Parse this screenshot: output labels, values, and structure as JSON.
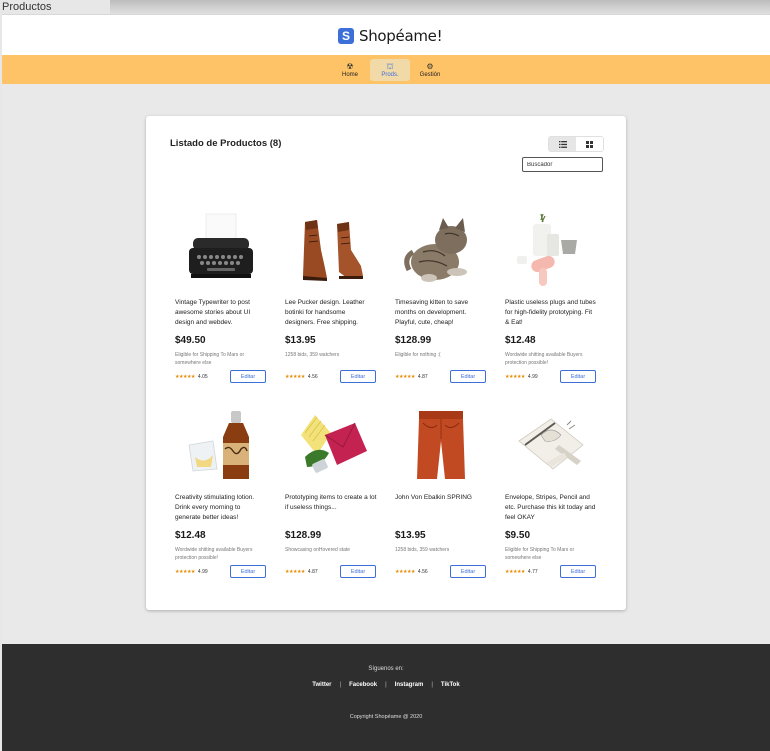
{
  "window": {
    "title": "Productos"
  },
  "brand": {
    "logo_letter": "S",
    "name": "Shopéame!",
    "accent": "#3d6fd9"
  },
  "nav": {
    "items": [
      {
        "icon": "radioactive-icon",
        "glyph": "☢",
        "label": "Home"
      },
      {
        "icon": "bag-icon",
        "glyph": "⛫",
        "label": "Prods."
      },
      {
        "icon": "gear-icon",
        "glyph": "⚙",
        "label": "Gestión"
      }
    ],
    "active": "Prods.",
    "bar_color": "#fdc366"
  },
  "listing": {
    "title": "Listado de Productos (8)",
    "view_modes": [
      "list",
      "grid"
    ],
    "active_view": "list",
    "search_placeholder": "Buscador"
  },
  "products": [
    {
      "title": "Vintage Typewriter to post awesome stories about UI design and webdev.",
      "price": "$49.50",
      "info": "Eligible for Shipping To Mars or somewhere else",
      "rating": "4.05",
      "button": "Editar",
      "image": "typewriter"
    },
    {
      "title": "Lee Pucker design. Leather botinki for handsome designers. Free shipping.",
      "price": "$13.95",
      "info": "1258 bids, 359 watchers",
      "rating": "4.56",
      "button": "Editar",
      "image": "boots"
    },
    {
      "title": "Timesaving kitten to save months on development. Playful, cute, cheap!",
      "price": "$128.99",
      "info": "Eligible for nothing :(",
      "rating": "4.87",
      "button": "Editar",
      "image": "kitten"
    },
    {
      "title": "Plastic useless plugs and tubes for high-fidelity prototyping. Fit & Eat!",
      "price": "$12.48",
      "info": "Wordwide shitting available Buyers protection possible!",
      "rating": "4.99",
      "button": "Editar",
      "image": "plugs"
    },
    {
      "title": "Creativity stimulating lotion. Drink every morning to generate better ideas!",
      "price": "$12.48",
      "info": "Wordwide shitting available Buyers protection possible!",
      "rating": "4.99",
      "button": "Editar",
      "image": "bottle"
    },
    {
      "title": "Prototyping items to create a lot if useless things...",
      "price": "$128.99",
      "info": "Showcasing onHovered state",
      "rating": "4.87",
      "button": "Editar",
      "image": "envelope-pink"
    },
    {
      "title": "John Von Ebalkin SPRING",
      "price": "$13.95",
      "info": "1258 bids, 359 watchers",
      "rating": "4.56",
      "button": "Editar",
      "image": "pants"
    },
    {
      "title": "Envelope, Stripes, Pencil and etc. Purchase this kit today and feel OKAY",
      "price": "$9.50",
      "info": "Eligible for Shipping To Mars or somewhere else",
      "rating": "4.77",
      "button": "Editar",
      "image": "kit"
    }
  ],
  "footer": {
    "follow": "Síguenos en:",
    "links": [
      "Twitter",
      "Facebook",
      "Instagram",
      "TikTok"
    ],
    "copyright": "Copyright Shopéame @ 2020"
  }
}
